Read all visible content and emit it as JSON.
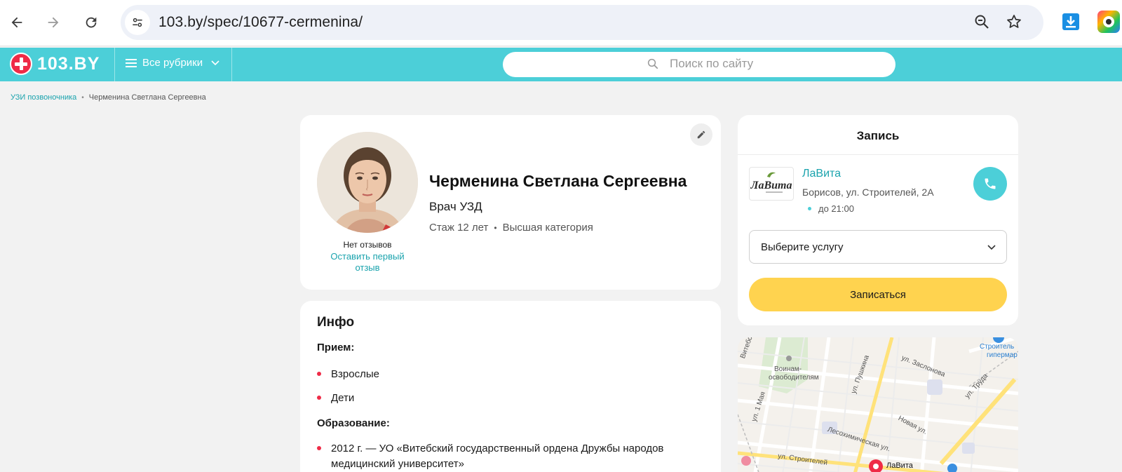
{
  "browser": {
    "url": "103.by/spec/10677-cermenina/"
  },
  "site": {
    "logo_text": "103.BY",
    "rubrics_label": "Все рубрики",
    "search_placeholder": "Поиск по сайту"
  },
  "breadcrumb": {
    "parent": "УЗИ позвоночника",
    "separator": "•",
    "current": "Черменина Светлана Сергеевна"
  },
  "profile": {
    "name": "Черменина Светлана Сергеевна",
    "specialty": "Врач УЗД",
    "experience": "Стаж 12 лет",
    "meta_separator": "•",
    "category": "Высшая категория",
    "reviews_none": "Нет отзывов",
    "leave_review": "Оставить первый отзыв"
  },
  "info": {
    "title": "Инфо",
    "reception_label": "Прием:",
    "reception_items": [
      "Взрослые",
      "Дети"
    ],
    "education_label": "Образование:",
    "education_items": [
      "2012 г. — УО «Витебский государственный ордена Дружбы народов медицинский университет»"
    ]
  },
  "booking": {
    "title": "Запись",
    "clinic_name": "ЛаВита",
    "clinic_address": "Борисов, ул. Строителей, 2А",
    "clinic_hours": "до 21:00",
    "service_placeholder": "Выберите услугу",
    "book_label": "Записаться"
  },
  "map": {
    "labels": {
      "vitebskaya": "Витебская ул.",
      "voinam": "Воинам-",
      "osvoboditelyam": "освободителям",
      "pushkina": "ул. Пушкина",
      "zaslonova": "ул. Заслонова",
      "truda": "ул. Труда",
      "stroitel": "Строитель",
      "gipermarket": "гипермар",
      "may1": "ул. 1 Мая",
      "novaya": "Новая ул.",
      "lesokhim": "Лесохимическая ул.",
      "stroiteley": "ул. Строителей",
      "lavita_pin": "ЛаВита"
    }
  },
  "colors": {
    "brand_teal": "#4ccfd8",
    "brand_red": "#ef2b47",
    "book_yellow": "#ffd34f",
    "link": "#1aa3ad"
  }
}
